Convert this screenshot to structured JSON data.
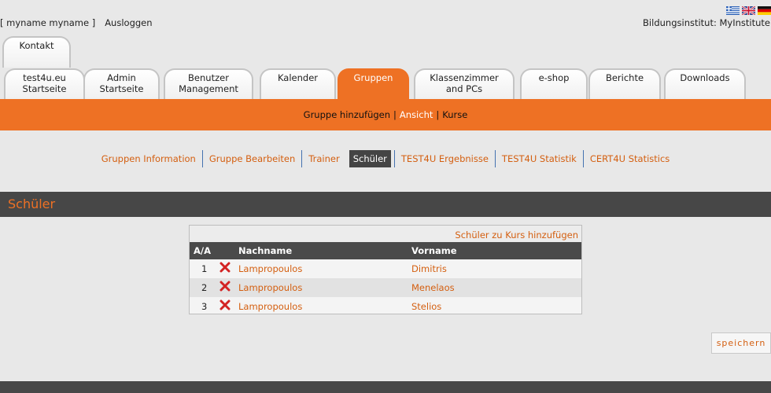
{
  "user": {
    "name_display": "[ myname myname ]",
    "logout": "Ausloggen"
  },
  "institute": "Bildungsinstitut: MyInstitute",
  "flags": [
    "greek-flag-icon",
    "uk-flag-icon",
    "german-flag-icon"
  ],
  "top_tab": "Kontakt",
  "tabs": [
    {
      "l1": "test4u.eu",
      "l2": "Startseite"
    },
    {
      "l1": "Admin",
      "l2": "Startseite"
    },
    {
      "l1": "Benutzer",
      "l2": "Management"
    },
    {
      "l1": "Kalender",
      "l2": ""
    },
    {
      "l1": "Gruppen",
      "l2": "",
      "active": true
    },
    {
      "l1": "Klassenzimmer",
      "l2": "and PCs"
    },
    {
      "l1": "e-shop",
      "l2": ""
    },
    {
      "l1": "Berichte",
      "l2": ""
    },
    {
      "l1": "Downloads",
      "l2": ""
    }
  ],
  "subnav": {
    "add_group": "Gruppe hinzufügen",
    "view": "Ansicht",
    "courses": "Kurse",
    "sep": "|"
  },
  "group_tabs": [
    "Gruppen Information",
    "Gruppe Bearbeiten",
    "Trainer",
    "Schüler",
    "TEST4U Ergebnisse",
    "TEST4U Statistik",
    "CERT4U Statistics"
  ],
  "active_group_tab": "Schüler",
  "section_title": "Schüler",
  "table": {
    "add_link": "Schüler zu Kurs hinzufügen",
    "headers": {
      "aa": "A/A",
      "lastname": "Nachname",
      "firstname": "Vorname"
    },
    "rows": [
      {
        "num": "1",
        "lastname": "Lampropoulos",
        "firstname": "Dimitris"
      },
      {
        "num": "2",
        "lastname": "Lampropoulos",
        "firstname": "Menelaos"
      },
      {
        "num": "3",
        "lastname": "Lampropoulos",
        "firstname": "Stelios"
      }
    ]
  },
  "save_button": "speichern",
  "colors": {
    "accent": "#ee7124",
    "dark": "#474747",
    "link": "#d45f10",
    "background": "#e8e8e8"
  }
}
